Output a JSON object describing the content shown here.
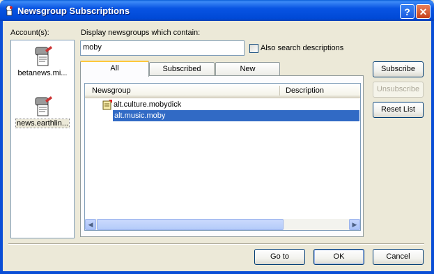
{
  "window": {
    "title": "Newsgroup Subscriptions",
    "help_glyph": "?",
    "close_glyph": "✕"
  },
  "accounts": {
    "label": "Account(s):",
    "items": [
      {
        "label": "betanews.mi...",
        "icon": "news-server-icon"
      },
      {
        "label": "news.earthlin...",
        "icon": "news-server-icon"
      }
    ]
  },
  "filter": {
    "label": "Display newsgroups which contain:",
    "value": "moby",
    "also_search_label": "Also search descriptions",
    "also_search_checked": false
  },
  "tabs": [
    {
      "label": "All"
    },
    {
      "label": "Subscribed"
    },
    {
      "label": "New"
    }
  ],
  "list": {
    "columns": [
      "Newsgroup",
      "Description"
    ],
    "rows": [
      {
        "name": "alt.culture.mobydick",
        "icon": "subscribed-newsgroup-icon"
      },
      {
        "name": "alt.music.moby"
      }
    ]
  },
  "side_buttons": {
    "subscribe": "Subscribe",
    "unsubscribe": "Unsubscribe",
    "reset": "Reset List"
  },
  "footer_buttons": {
    "goto": "Go to",
    "ok": "OK",
    "cancel": "Cancel"
  },
  "colors": {
    "selection": "#316ac5",
    "tab_accent": "#ffc83c",
    "titlebar": "#0054e3"
  }
}
